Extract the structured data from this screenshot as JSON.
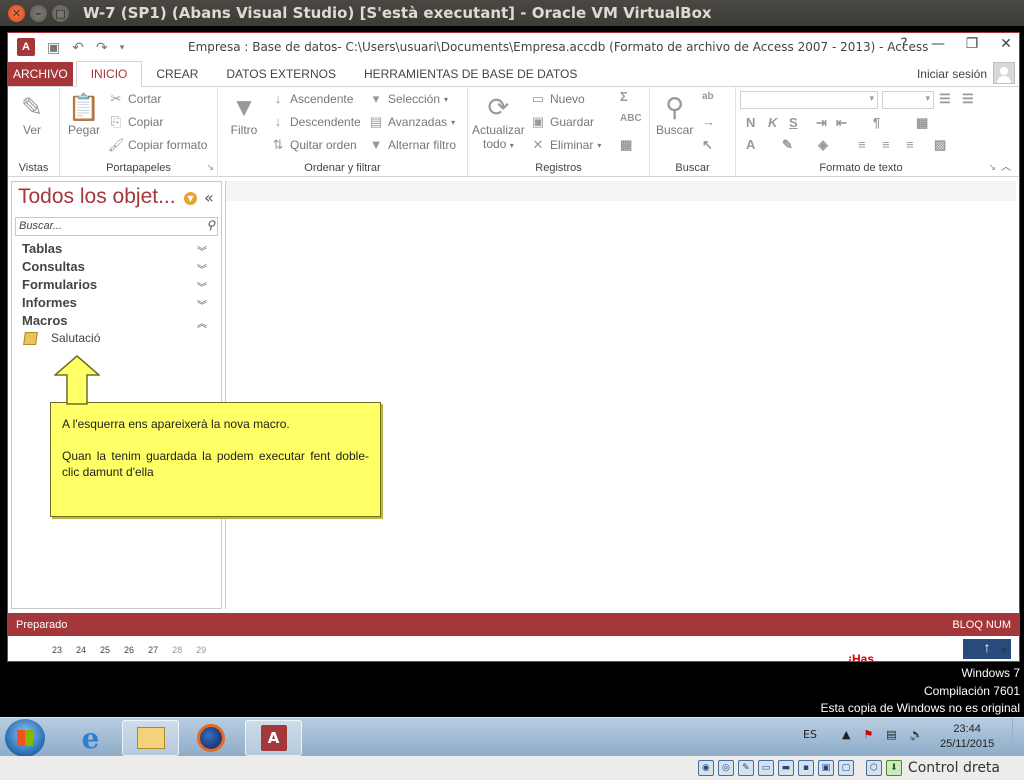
{
  "vbox": {
    "title": "W-7 (SP1) (Abans Visual Studio) [S'està executant] - Oracle VM VirtualBox",
    "host_key_label": "Control dreta"
  },
  "access": {
    "window_title": "Empresa : Base de datos- C:\\Users\\usuari\\Documents\\Empresa.accdb (Formato de archivo de Access 2007 - 2013) - Access",
    "help": "?",
    "tabs": [
      {
        "label": "ARCHIVO"
      },
      {
        "label": "INICIO"
      },
      {
        "label": "CREAR"
      },
      {
        "label": "DATOS EXTERNOS"
      },
      {
        "label": "HERRAMIENTAS DE BASE DE DATOS"
      }
    ],
    "sign_in": "Iniciar sesión"
  },
  "ribbon": {
    "vistas": {
      "label": "Vistas",
      "ver": "Ver"
    },
    "portapapeles": {
      "label": "Portapapeles",
      "pegar": "Pegar",
      "cortar": "Cortar",
      "copiar": "Copiar",
      "copiar_formato": "Copiar formato"
    },
    "ordenar": {
      "label": "Ordenar y filtrar",
      "filtro": "Filtro",
      "ascendente": "Ascendente",
      "descendente": "Descendente",
      "quitar_orden": "Quitar orden",
      "seleccion": "Selección",
      "avanzadas": "Avanzadas",
      "alternar_filtro": "Alternar filtro"
    },
    "registros": {
      "label": "Registros",
      "actualizar": "Actualizar",
      "todo": "todo",
      "nuevo": "Nuevo",
      "guardar": "Guardar",
      "eliminar": "Eliminar"
    },
    "buscar": {
      "label": "Buscar",
      "buscar": "Buscar"
    },
    "formato": {
      "label": "Formato de texto",
      "bold": "N",
      "italic": "K",
      "underline": "S"
    }
  },
  "nav": {
    "title": "Todos los objet...",
    "search_placeholder": "Buscar...",
    "groups": [
      {
        "label": "Tablas",
        "expanded": false
      },
      {
        "label": "Consultas",
        "expanded": false
      },
      {
        "label": "Formularios",
        "expanded": false
      },
      {
        "label": "Informes",
        "expanded": false
      },
      {
        "label": "Macros",
        "expanded": true
      }
    ],
    "macro_item": "Salutació"
  },
  "callout": {
    "line1": "A l'esquerra ens apareixerà la nova macro.",
    "line2": "Quan la tenim guardada la podem executar fent doble-clic damunt d'ella"
  },
  "status": {
    "left": "Preparado",
    "right": "BLOQ NUM"
  },
  "peek": {
    "numbers": [
      "23",
      "24",
      "25",
      "26",
      "27",
      "28",
      "29"
    ],
    "red_text": "¡Has"
  },
  "watermark": {
    "line1": "Windows 7",
    "line2": "Compilación  7601",
    "line3": "Esta copia de Windows no es original"
  },
  "taskbar": {
    "lang": "ES",
    "time": "23:44",
    "date": "25/11/2015"
  }
}
